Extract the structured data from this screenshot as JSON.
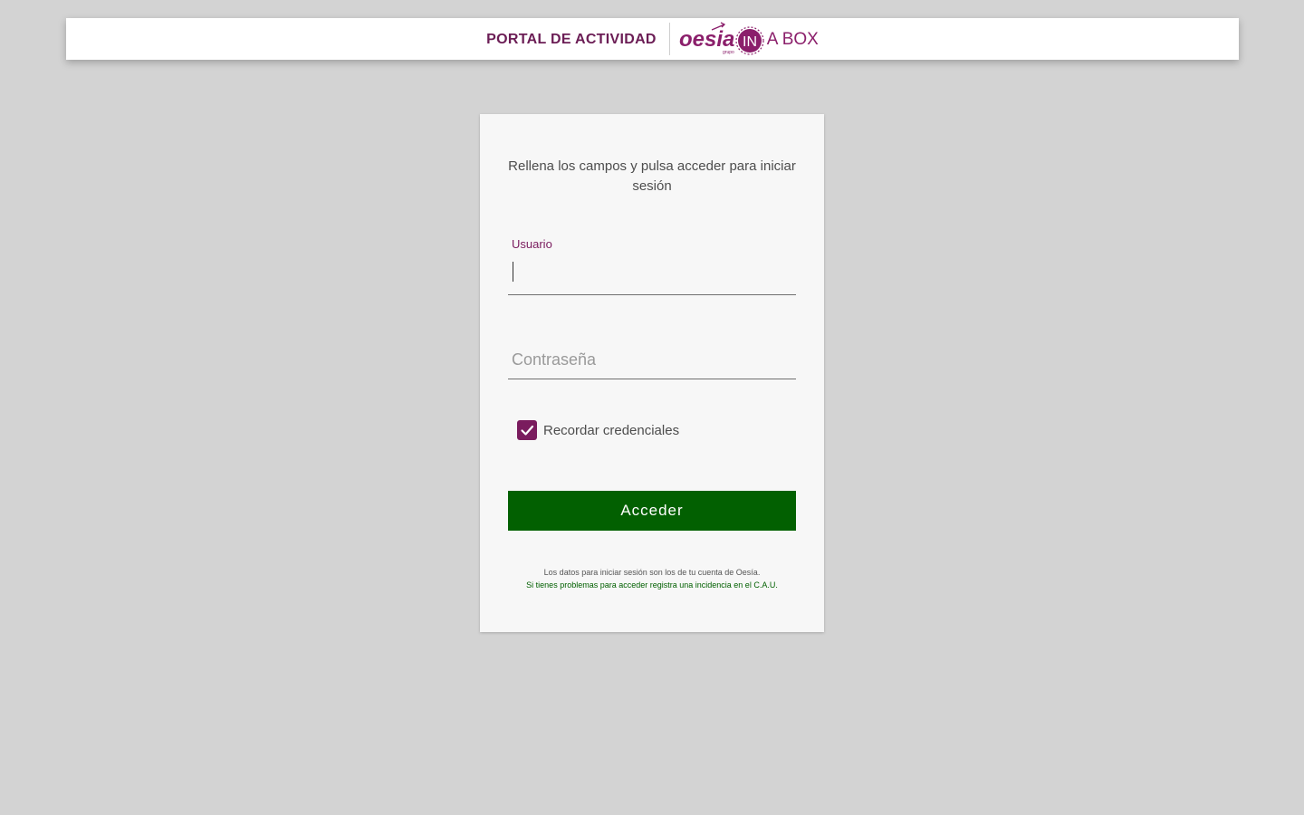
{
  "header": {
    "portal_title": "PORTAL DE ACTIVIDAD",
    "brand_name": "oesia",
    "brand_sub": "grupo",
    "brand_in": "IN",
    "brand_suffix": "A BOX",
    "brand_color": "#8b1f6b"
  },
  "login": {
    "intro": "Rellena los campos y pulsa acceder para iniciar sesión",
    "username": {
      "label": "Usuario",
      "value": ""
    },
    "password": {
      "placeholder": "Contraseña",
      "value": ""
    },
    "remember": {
      "label": "Recordar credenciales",
      "checked": true,
      "icon": "check-icon"
    },
    "submit_label": "Acceder",
    "button_color": "#026001",
    "accent_color": "#7a1c5e",
    "footnote_line1": "Los datos para iniciar sesión son los de tu cuenta de Oesía.",
    "footnote_line2": "Si tienes problemas para acceder registra una incidencia en el C.A.U."
  }
}
